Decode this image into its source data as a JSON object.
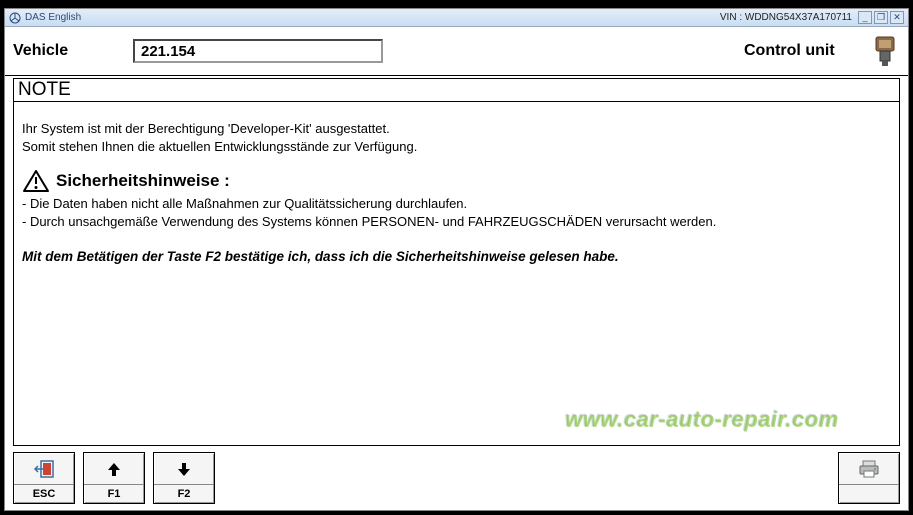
{
  "titlebar": {
    "app_title": "DAS English",
    "vin_label": "VIN : WDDNG54X37A170711"
  },
  "window_controls": {
    "min": "_",
    "restore": "❐",
    "close": "✕"
  },
  "header": {
    "vehicle_label": "Vehicle",
    "vehicle_value": "221.154",
    "control_unit_label": "Control unit"
  },
  "note": {
    "label": "NOTE"
  },
  "body": {
    "line1": "Ihr System ist mit der Berechtigung 'Developer-Kit' ausgestattet.",
    "line2": "Somit stehen Ihnen die aktuellen Entwicklungsstände zur Verfügung.",
    "safety_title": "Sicherheitshinweise :",
    "bullet1": "- Die Daten haben nicht alle Maßnahmen zur Qualitätssicherung durchlaufen.",
    "bullet2": "- Durch unsachgemäße Verwendung des Systems können PERSONEN- und FAHRZEUGSCHÄDEN verursacht werden.",
    "confirm": "Mit dem Betätigen der Taste F2 bestätige ich, dass ich die Sicherheitshinweise gelesen habe."
  },
  "fkeys": {
    "esc": "ESC",
    "f1": "F1",
    "f2": "F2"
  },
  "watermark": "www.car-auto-repair.com"
}
